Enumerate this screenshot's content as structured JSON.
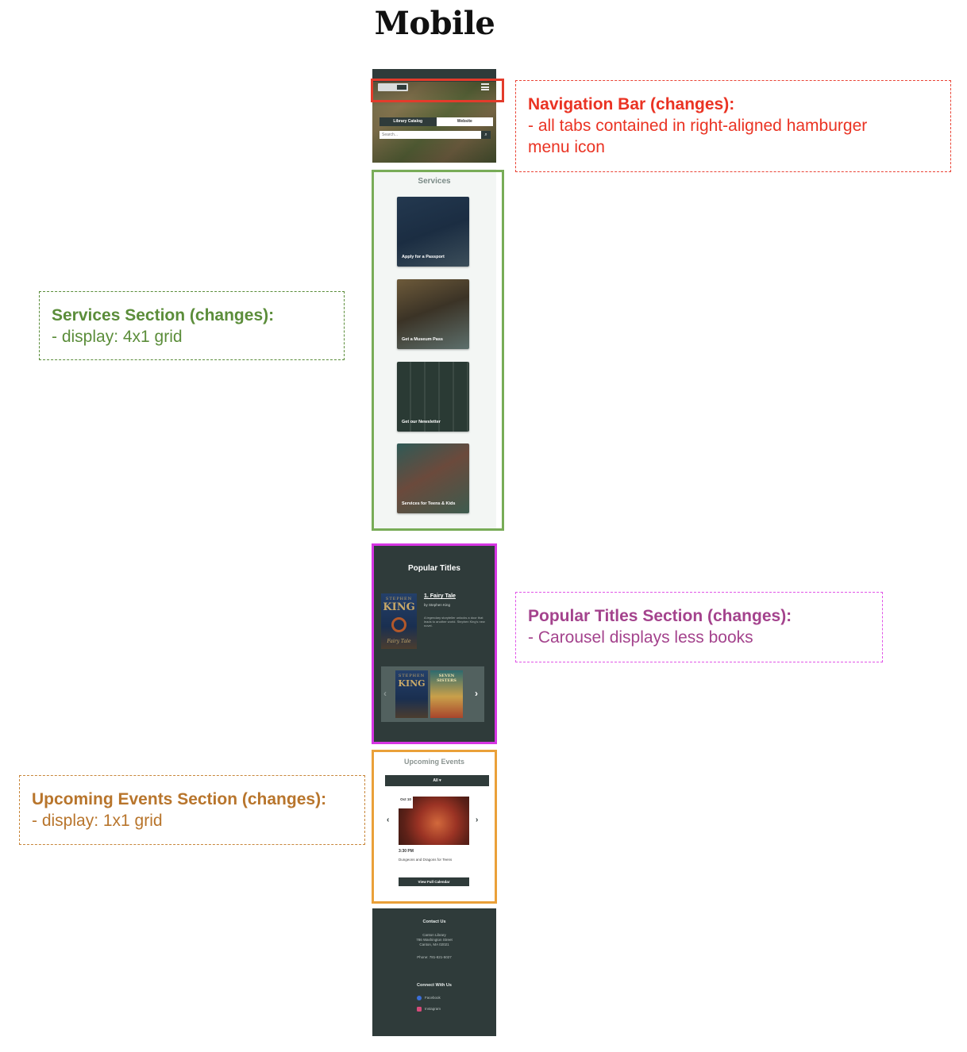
{
  "title": "Mobile",
  "mockup": {
    "nav": {
      "tabs": [
        "Library Catalog",
        "Website"
      ],
      "search_placeholder": "Search...",
      "search_icon": "magnifier-icon",
      "menu_icon": "hamburger-icon"
    },
    "services": {
      "heading": "Services",
      "cards": [
        "Apply for a Passport",
        "Get a Museum Pass",
        "Get our Newsletter",
        "Services for Teens & Kids"
      ]
    },
    "popular": {
      "heading": "Popular Titles",
      "featured": {
        "cover_author": "STEPHEN",
        "cover_name": "KING",
        "cover_title": "Fairy Tale",
        "title": "1. Fairy Tale",
        "author": "by Stephen King",
        "description": "A legendary storyteller unlocks a door that leads to another world. Stephen King's new novel."
      },
      "carousel_cover2": "SEVEN SISTERS",
      "prev_icon": "chevron-left-icon",
      "next_icon": "chevron-right-icon"
    },
    "events": {
      "heading": "Upcoming Events",
      "filter": "All ▾",
      "date": "Oct 10",
      "time": "3:30 PM",
      "name": "Dungeons and Dragons for Teens",
      "calendar_button": "View Full Calendar"
    },
    "footer": {
      "contact_heading": "Contact Us",
      "address_lines": [
        "Canton Library",
        "786 Washington Street",
        "Canton, MA 02021"
      ],
      "phone": "Phone: 781-821-5027",
      "connect_heading": "Connect With Us",
      "social": [
        "Facebook",
        "Instagram"
      ]
    }
  },
  "annotations": {
    "nav": {
      "title": "Navigation Bar (changes):",
      "lines": [
        "- all tabs contained in right-aligned hamburger",
        "menu icon"
      ]
    },
    "services": {
      "title": "Services Section (changes):",
      "lines": [
        "- display: 4x1 grid"
      ]
    },
    "popular": {
      "title": "Popular Titles Section (changes):",
      "lines": [
        "- Carousel displays less books"
      ]
    },
    "events": {
      "title": "Upcoming Events Section (changes):",
      "lines": [
        "- display: 1x1 grid"
      ]
    }
  },
  "colors": {
    "nav": "#ea4335",
    "services": "#78ac57",
    "popular": "#d635e3",
    "events": "#eaa039",
    "site_dark": "#2f3b3a"
  }
}
